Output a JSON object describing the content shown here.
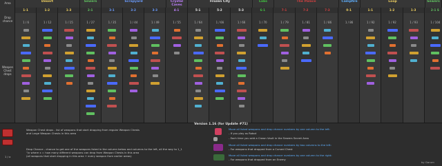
{
  "left_labels": {
    "area": "Area",
    "drop_chance": "Drop chance",
    "weapon_chest_drops": "Weapon Chest drops"
  },
  "areas": [
    {
      "name": "Desert",
      "color": "#f0d060"
    },
    {
      "name": "Sewers",
      "color": "#60c060"
    },
    {
      "name": "Scrapyard",
      "color": "#6a9cff"
    },
    {
      "name": "Crystal Caves",
      "color": "#c080ff"
    },
    {
      "name": "Frozen City",
      "color": "#e8e8e8"
    },
    {
      "name": "Labs",
      "color": "#40c040"
    },
    {
      "name": "The Palace",
      "color": "#d04040"
    },
    {
      "name": "Campfire",
      "color": "#5fb0ff"
    },
    {
      "name": "Loop",
      "color": "#f0d060"
    },
    {
      "name": "Loop Desert",
      "color": "#f0d060"
    },
    {
      "name": "Sewers",
      "color": "#60c060"
    }
  ],
  "stages": [
    "1-1",
    "1-2",
    "1-3",
    "2-1",
    "3-1",
    "3-2",
    "3-3",
    "4-1",
    "5-1",
    "5-2",
    "5-3",
    "6-1",
    "7-1",
    "7-2",
    "7-3",
    "0-1",
    "1-1",
    "1-2",
    "1-3",
    "2-1 S"
  ],
  "stage_colors": [
    "#f0d060",
    "#f0d060",
    "#f0d060",
    "#60c060",
    "#6a9cff",
    "#6a9cff",
    "#6a9cff",
    "#c080ff",
    "#e8e8e8",
    "#e8e8e8",
    "#e8e8e8",
    "#40c040",
    "#d04040",
    "#d04040",
    "#d04040",
    "#f0d060",
    "#f0d060",
    "#f0d060",
    "#f0d060",
    "#60c060"
  ],
  "drop_chances": [
    "1 / 6",
    "1 / 12",
    "1 / 15",
    "1 / 27",
    "1 / 35",
    "1 / 44",
    "1 / 49",
    "1 / 55",
    "1 / 64",
    "1 / 66",
    "1 / 66",
    "1 / 70",
    "1 / 79",
    "1 / 81",
    "1 / 86",
    "1 / 86",
    "1 / 92",
    "1 / 92",
    "1 / 93",
    "1 / 104"
  ],
  "footer": {
    "version": "Version 1.16 (for Update #71)",
    "wc_line1": "Weapon Chest drops - list of weapons that start dropping from regular Weapon Chests",
    "wc_line2": "and Large Weapon Chests in this area",
    "dc_line1": "Drop Chance - chance to get one of the weapons listed in the column below and columns to the left, all the way to 1_1",
    "dc_line2": "\"/x where x = how many different weapons can drop from Weapon Chests in this area",
    "dc_line3": "(all weapons that start dropping in this area + every weapon from earlier areas)",
    "fraction": "1 / x",
    "r1_line1": "Move all listed weapons and drop chance numbers by one column to the left:",
    "r1_line2": "- If you play as Robot",
    "r1_line3": "- Each time you add a Crown Vault in the Sewers Secret Area",
    "r2_line1": "Move all listed weapons and drop chance numbers by two columns to the left:",
    "r2_line2": "- For weapons that dropped from a Cursed Chest",
    "r3_line1": "Move all listed weapons and drop chance numbers by one column to the right:",
    "r3_line2": "- For weapons that dropped from an Enemy",
    "credit": "by Garum"
  }
}
